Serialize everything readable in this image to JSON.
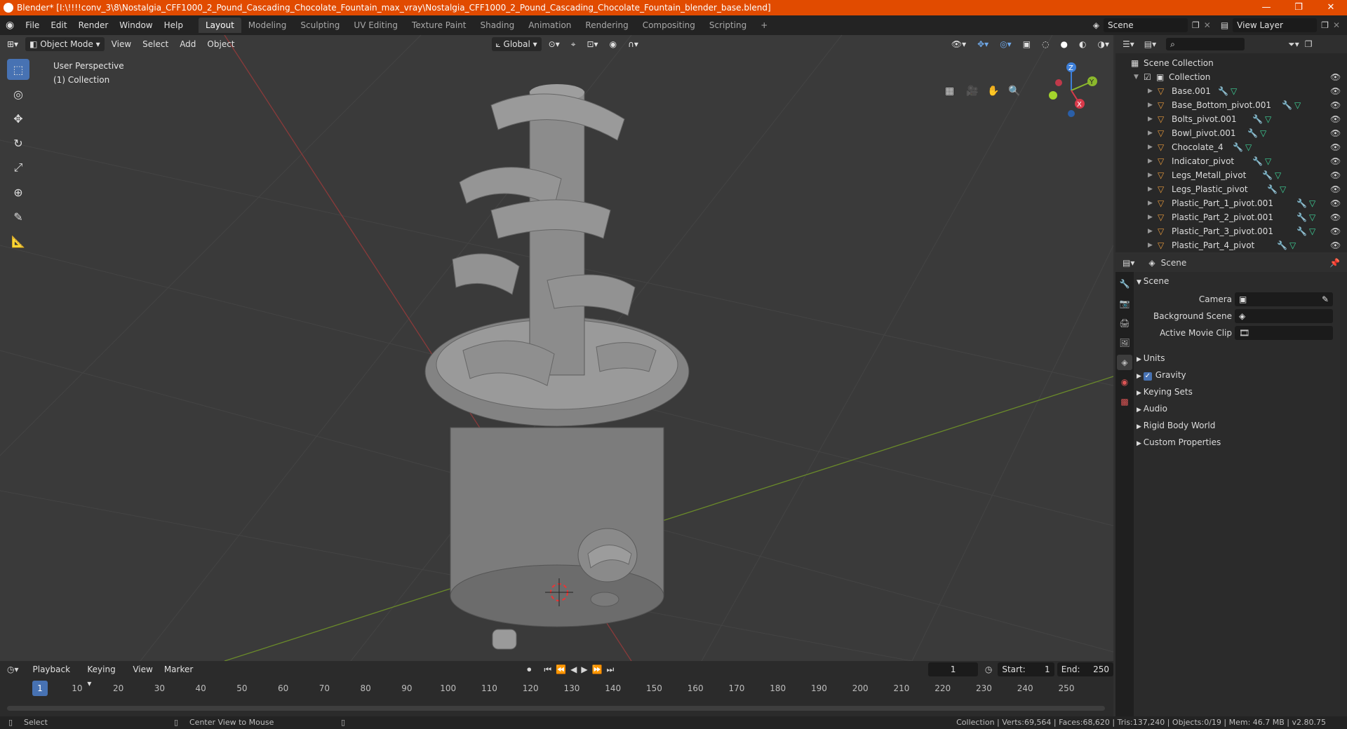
{
  "window": {
    "title": "Blender* [I:\\!!!!conv_3\\8\\Nostalgia_CFF1000_2_Pound_Cascading_Chocolate_Fountain_max_vray\\Nostalgia_CFF1000_2_Pound_Cascading_Chocolate_Fountain_blender_base.blend]",
    "minimize": "—",
    "maximize": "❐",
    "close": "✕"
  },
  "menu": [
    "File",
    "Edit",
    "Render",
    "Window",
    "Help"
  ],
  "workspaces": [
    "Layout",
    "Modeling",
    "Sculpting",
    "UV Editing",
    "Texture Paint",
    "Shading",
    "Animation",
    "Rendering",
    "Compositing",
    "Scripting"
  ],
  "active_workspace": "Layout",
  "scene_field": "Scene",
  "view_layer_field": "View Layer",
  "viewport": {
    "mode": "Object Mode",
    "menus": [
      "View",
      "Select",
      "Add",
      "Object"
    ],
    "transform_orientation": "Global",
    "perspective": "User Perspective",
    "collection": "(1) Collection",
    "gizmo_axes": {
      "x": "X",
      "y": "Y",
      "z": "Z"
    }
  },
  "outliner": {
    "scene_collection": "Scene Collection",
    "collection": "Collection",
    "items": [
      "Base.001",
      "Base_Bottom_pivot.001",
      "Bolts_pivot.001",
      "Bowl_pivot.001",
      "Chocolate_4",
      "Indicator_pivot",
      "Legs_Metall_pivot",
      "Legs_Plastic_pivot",
      "Plastic_Part_1_pivot.001",
      "Plastic_Part_2_pivot.001",
      "Plastic_Part_3_pivot.001",
      "Plastic_Part_4_pivot"
    ]
  },
  "properties": {
    "context": "Scene",
    "panel": "Scene",
    "fields": [
      {
        "label": "Camera"
      },
      {
        "label": "Background Scene"
      },
      {
        "label": "Active Movie Clip"
      }
    ],
    "sections": [
      "Units",
      "Gravity",
      "Keying Sets",
      "Audio",
      "Rigid Body World",
      "Custom Properties"
    ],
    "gravity_checked": true
  },
  "timeline": {
    "menus": [
      "Playback",
      "Keying",
      "View",
      "Marker"
    ],
    "current_frame": "1",
    "start_label": "Start:",
    "start": "1",
    "end_label": "End:",
    "end": "250",
    "ticks": [
      "1",
      "10",
      "20",
      "30",
      "40",
      "50",
      "60",
      "70",
      "80",
      "90",
      "100",
      "110",
      "120",
      "130",
      "140",
      "150",
      "160",
      "170",
      "180",
      "190",
      "200",
      "210",
      "220",
      "230",
      "240",
      "250"
    ]
  },
  "status": {
    "left1": "Select",
    "left2": "Center View to Mouse",
    "right": "Collection | Verts:69,564 | Faces:68,620 | Tris:137,240 | Objects:0/19 | Mem: 46.7 MB | v2.80.75"
  }
}
